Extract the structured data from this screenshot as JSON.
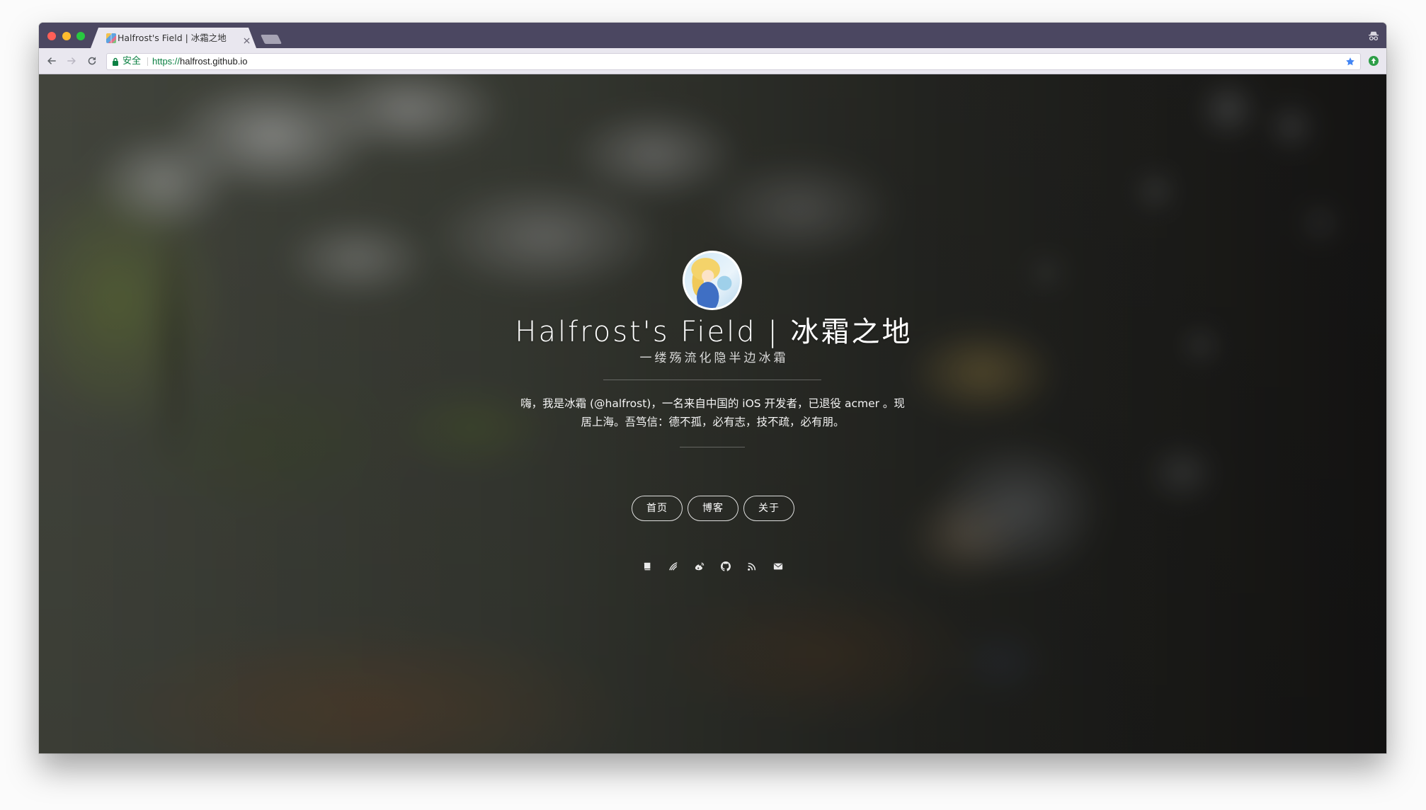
{
  "colors": {
    "tabbar": "#4b4761",
    "chrome": "#e9e7ef",
    "secure": "#0b8043",
    "star": "#4285f4",
    "extension": "#2e9e48",
    "close_light": "#ff5f57",
    "minimize_light": "#febc2e",
    "zoom_light": "#28c840"
  },
  "browser": {
    "tab": {
      "title": "Halfrost's Field | 冰霜之地",
      "favicon": "favicon",
      "close_icon": "tab-close-icon"
    },
    "new_tab_icon": "new-tab-icon",
    "incognito_icon": "incognito-icon",
    "toolbar": {
      "back_icon": "back-arrow-icon",
      "forward_icon": "forward-arrow-icon",
      "reload_icon": "reload-icon",
      "security_icon": "lock-icon",
      "security_label": "安全",
      "url_scheme": "https://",
      "url_host": "halfrost.github.io",
      "bookmark_icon": "star-icon",
      "extension_icon": "extension-icon"
    }
  },
  "hero": {
    "title": "Halfrost's Field | 冰霜之地",
    "subtitle": "一缕殇流化隐半边冰霜",
    "intro_lines": [
      "嗨，我是冰霜 (@halfrost)，一名来自中国的 iOS 开发者，已退役 acmer 。现",
      "居上海。吾笃信：德不孤，必有志，技不疏，必有朋。"
    ]
  },
  "nav": [
    {
      "label": "首页"
    },
    {
      "label": "博客"
    },
    {
      "label": "关于"
    }
  ],
  "social": [
    {
      "icon": "book-icon"
    },
    {
      "icon": "feather-icon"
    },
    {
      "icon": "weibo-icon"
    },
    {
      "icon": "github-icon"
    },
    {
      "icon": "rss-icon"
    },
    {
      "icon": "email-icon"
    }
  ]
}
